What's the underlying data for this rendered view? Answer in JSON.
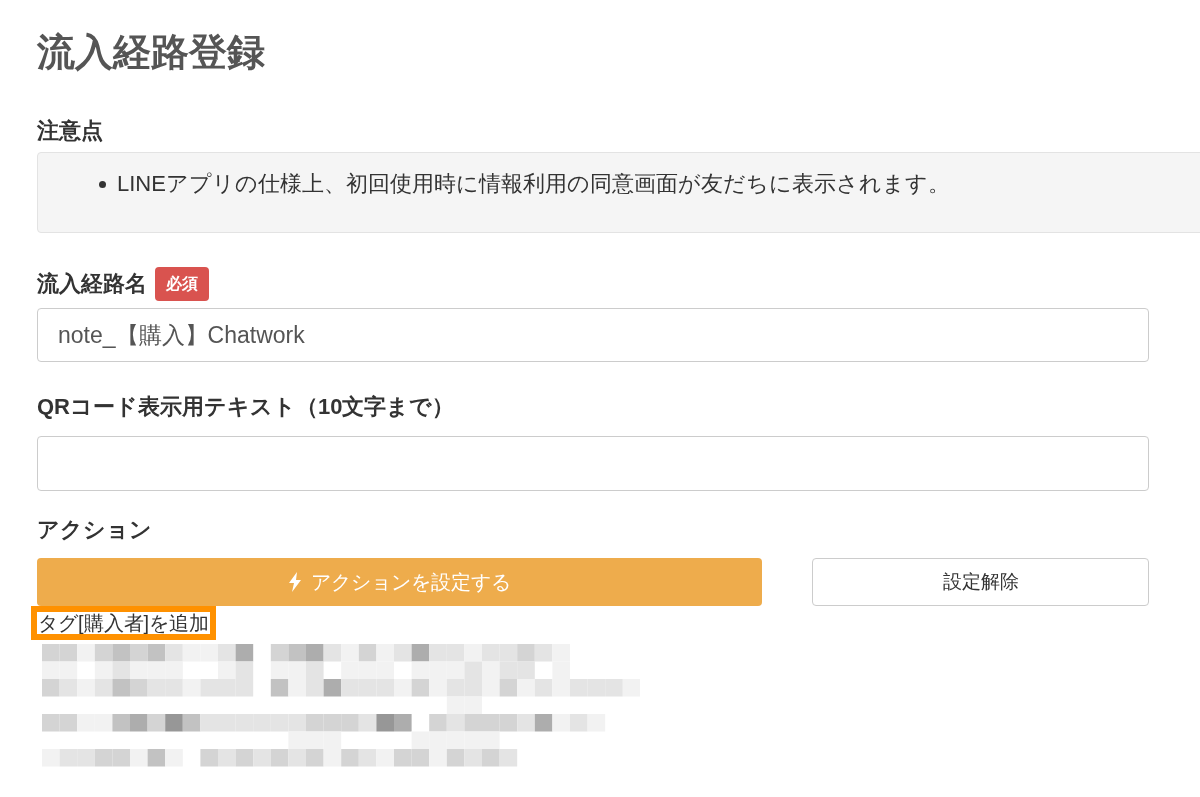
{
  "page": {
    "title": "流入経路登録"
  },
  "notes": {
    "heading": "注意点",
    "items": [
      "LINEアプリの仕様上、初回使用時に情報利用の同意画面が友だちに表示されます。"
    ]
  },
  "fields": [
    {
      "label": "流入経路名",
      "required_badge": "必須",
      "value": "note_【購入】Chatwork"
    },
    {
      "label": "QRコード表示用テキスト（10文字まで）"
    }
  ],
  "action": {
    "heading": "アクション",
    "buttons": [
      {
        "kind": "primary",
        "label": "アクションを設定する"
      },
      {
        "kind": "secondary",
        "label": "設定解除"
      }
    ],
    "result": {
      "text": "タグ[購入者]を追加",
      "highlighted": true
    }
  }
}
